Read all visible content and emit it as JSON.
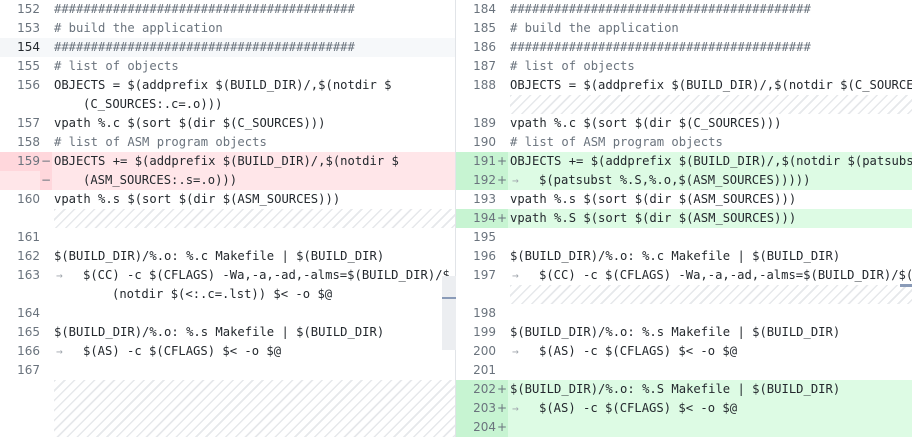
{
  "left": {
    "rows": [
      {
        "ln": "152",
        "mk": "",
        "t": "#########################################",
        "k": "cm"
      },
      {
        "ln": "153",
        "mk": "",
        "t": "# build the application",
        "k": "cm"
      },
      {
        "ln": "154",
        "mk": "",
        "t": "#########################################",
        "k": "cm",
        "cur": true
      },
      {
        "ln": "155",
        "mk": "",
        "t": "# list of objects",
        "k": "cm"
      },
      {
        "ln": "156",
        "mk": "",
        "t": "OBJECTS = $(addprefix $(BUILD_DIR)/,$(notdir $"
      },
      {
        "ln": "",
        "mk": "",
        "t": "(C_SOURCES:.c=.o)))",
        "cont": true
      },
      {
        "ln": "157",
        "mk": "",
        "t": "vpath %.c $(sort $(dir $(C_SOURCES)))"
      },
      {
        "ln": "158",
        "mk": "",
        "t": "# list of ASM program objects",
        "k": "cm"
      },
      {
        "ln": "159",
        "mk": "−",
        "t": "OBJECTS += $(addprefix $(BUILD_DIR)/,$(notdir $",
        "del": true
      },
      {
        "ln": "",
        "mk": "−",
        "t": "(ASM_SOURCES:.s=.o)))",
        "cont": true,
        "del": true
      },
      {
        "ln": "160",
        "mk": "",
        "t": "vpath %.s $(sort $(dir $(ASM_SOURCES)))"
      },
      {
        "ln": "",
        "mk": "",
        "t": "",
        "hatch": true
      },
      {
        "ln": "161",
        "mk": "",
        "t": ""
      },
      {
        "ln": "162",
        "mk": "",
        "t": "$(BUILD_DIR)/%.o: %.c Makefile | $(BUILD_DIR)"
      },
      {
        "ln": "163",
        "mk": "",
        "t": "$(CC) -c $(CFLAGS) -Wa,-a,-ad,-alms=$(BUILD_DIR)/$",
        "cont": true,
        "tab": true
      },
      {
        "ln": "",
        "mk": "",
        "t": "(notdir $(<:.c=.lst)) $< -o $@",
        "cont2": true
      },
      {
        "ln": "164",
        "mk": "",
        "t": ""
      },
      {
        "ln": "165",
        "mk": "",
        "t": "$(BUILD_DIR)/%.o: %.s Makefile | $(BUILD_DIR)"
      },
      {
        "ln": "166",
        "mk": "",
        "t": "$(AS) -c $(CFLAGS) $< -o $@",
        "cont": true,
        "tab": true
      },
      {
        "ln": "167",
        "mk": "",
        "t": ""
      },
      {
        "ln": "",
        "mk": "",
        "t": "",
        "hatch": true
      },
      {
        "ln": "",
        "mk": "",
        "t": "",
        "hatch": true
      },
      {
        "ln": "",
        "mk": "",
        "t": "",
        "hatch": true
      }
    ]
  },
  "right": {
    "rows": [
      {
        "ln": "184",
        "mk": "",
        "t": "#########################################",
        "k": "cm"
      },
      {
        "ln": "185",
        "mk": "",
        "t": "# build the application",
        "k": "cm"
      },
      {
        "ln": "186",
        "mk": "",
        "t": "#########################################",
        "k": "cm"
      },
      {
        "ln": "187",
        "mk": "",
        "t": "# list of objects",
        "k": "cm"
      },
      {
        "ln": "188",
        "mk": "",
        "t": "OBJECTS = $(addprefix $(BUILD_DIR)/,$(notdir $(C_SOURCES:.c=.o)))"
      },
      {
        "ln": "",
        "mk": "",
        "t": "",
        "hatch": true
      },
      {
        "ln": "189",
        "mk": "",
        "t": "vpath %.c $(sort $(dir $(C_SOURCES)))"
      },
      {
        "ln": "190",
        "mk": "",
        "t": "# list of ASM program objects",
        "k": "cm"
      },
      {
        "ln": "191",
        "mk": "+",
        "t": "OBJECTS += $(addprefix $(BUILD_DIR)/,$(notdir $(patsubst %.s,%.o,$(ASM_SOURCES)))",
        "add": true
      },
      {
        "ln": "192",
        "mk": "+",
        "t": "$(patsubst %.S,%.o,$(ASM_SOURCES)))))",
        "cont": true,
        "tab": true,
        "add": true
      },
      {
        "ln": "193",
        "mk": "",
        "t": "vpath %.s $(sort $(dir $(ASM_SOURCES)))"
      },
      {
        "ln": "194",
        "mk": "+",
        "t": "vpath %.S $(sort $(dir $(ASM_SOURCES)))",
        "add": true
      },
      {
        "ln": "195",
        "mk": "",
        "t": ""
      },
      {
        "ln": "196",
        "mk": "",
        "t": "$(BUILD_DIR)/%.o: %.c Makefile | $(BUILD_DIR)"
      },
      {
        "ln": "197",
        "mk": "",
        "t": "$(CC) -c $(CFLAGS) -Wa,-a,-ad,-alms=$(BUILD_DIR)/$(notdir $(<:.c=.lst)) $< -o $@",
        "cont": true,
        "tab": true
      },
      {
        "ln": "",
        "mk": "",
        "t": "",
        "hatch": true
      },
      {
        "ln": "198",
        "mk": "",
        "t": ""
      },
      {
        "ln": "199",
        "mk": "",
        "t": "$(BUILD_DIR)/%.o: %.s Makefile | $(BUILD_DIR)"
      },
      {
        "ln": "200",
        "mk": "",
        "t": "$(AS) -c $(CFLAGS) $< -o $@",
        "cont": true,
        "tab": true
      },
      {
        "ln": "201",
        "mk": "",
        "t": ""
      },
      {
        "ln": "202",
        "mk": "+",
        "t": "$(BUILD_DIR)/%.o: %.S Makefile | $(BUILD_DIR)",
        "add": true
      },
      {
        "ln": "203",
        "mk": "+",
        "t": "$(AS) -c $(CFLAGS) $< -o $@",
        "cont": true,
        "tab": true,
        "add": true
      },
      {
        "ln": "204",
        "mk": "+",
        "t": "",
        "add": true
      }
    ]
  }
}
